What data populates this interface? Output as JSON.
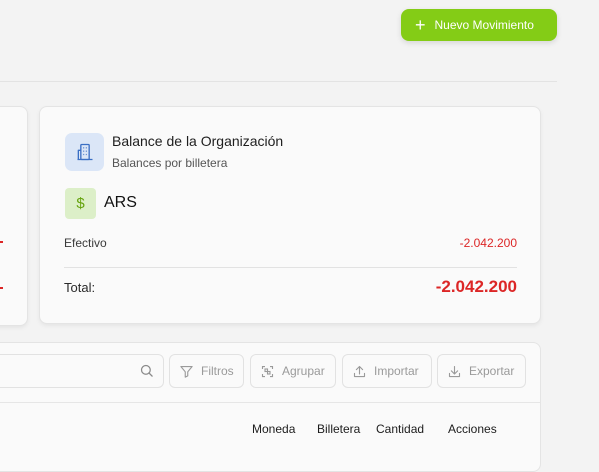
{
  "header": {
    "new_movement_label": "Nuevo Movimiento"
  },
  "balance_card": {
    "title": "Balance de la Organización",
    "subtitle": "Balances por billetera",
    "currency_code": "ARS",
    "currency_symbol": "$",
    "rows": [
      {
        "label": "Efectivo",
        "value": "-2.042.200"
      }
    ],
    "total_label": "Total:",
    "total_value": "-2.042.200"
  },
  "toolbar": {
    "filters_label": "Filtros",
    "group_label": "Agrupar",
    "import_label": "Importar",
    "export_label": "Exportar"
  },
  "table": {
    "columns": [
      "Moneda",
      "Billetera",
      "Cantidad",
      "Acciones"
    ]
  },
  "colors": {
    "accent_green": "#84cc16",
    "negative_red": "#dc2626",
    "org_icon_bg": "#dbe6f7",
    "currency_icon_bg": "#dcefc8"
  }
}
